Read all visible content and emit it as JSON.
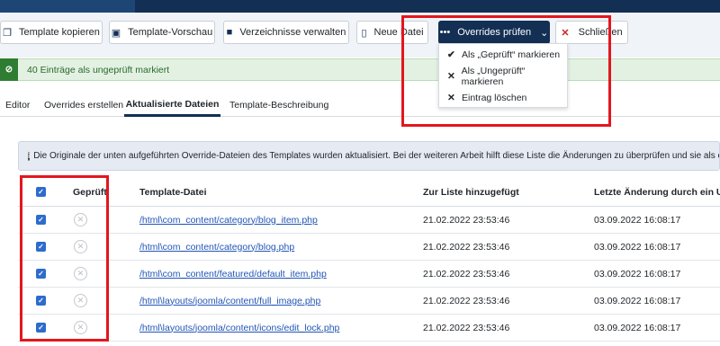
{
  "toolbar": {
    "copy_template": "Template kopieren",
    "preview": "Template-Vorschau",
    "manage_folders": "Verzeichnisse verwalten",
    "new_file": "Neue Datei",
    "check_overrides": "Overrides prüfen",
    "close": "Schließen"
  },
  "dropdown": {
    "items": [
      {
        "label": "Als „Geprüft“ markieren",
        "icon": "check-icon"
      },
      {
        "label": "Als „Ungeprüft“ markieren",
        "icon": "x-icon"
      },
      {
        "label": "Eintrag löschen",
        "icon": "x-icon"
      }
    ]
  },
  "alert": {
    "message": "40 Einträge als ungeprüft markiert"
  },
  "tabs": [
    {
      "label": "Editor"
    },
    {
      "label": "Overrides erstellen"
    },
    {
      "label": "Aktualisierte Dateien",
      "active": true
    },
    {
      "label": "Template-Beschreibung"
    }
  ],
  "info": {
    "text": "Die Originale der unten aufgeführten Override-Dateien des Templates wurden aktualisiert. Bei der weiteren Arbeit hilft diese Liste die Änderungen zu überprüfen und sie als erledigt zu"
  },
  "table": {
    "headers": {
      "checked": "Geprüft",
      "file": "Template-Datei",
      "added": "Zur Liste hinzugefügt",
      "modified": "Letzte Änderung durch ein Updat"
    },
    "rows": [
      {
        "file": "/html\\com_content/category/blog_item.php",
        "added": "21.02.2022 23:53:46",
        "modified": "03.09.2022 16:08:17"
      },
      {
        "file": "/html\\com_content/category/blog.php",
        "added": "21.02.2022 23:53:46",
        "modified": "03.09.2022 16:08:17"
      },
      {
        "file": "/html\\com_content/featured/default_item.php",
        "added": "21.02.2022 23:53:46",
        "modified": "03.09.2022 16:08:17"
      },
      {
        "file": "/html\\layouts/joomla/content/full_image.php",
        "added": "21.02.2022 23:53:46",
        "modified": "03.09.2022 16:08:17"
      },
      {
        "file": "/html\\layouts/joomla/content/icons/edit_lock.php",
        "added": "21.02.2022 23:53:46",
        "modified": "03.09.2022 16:08:17"
      }
    ]
  },
  "colors": {
    "navy": "#132f53",
    "highlight_red": "#e3161f",
    "success_green": "#2f7d32",
    "checkbox_blue": "#2d6ccc",
    "link_blue": "#2255b5"
  }
}
